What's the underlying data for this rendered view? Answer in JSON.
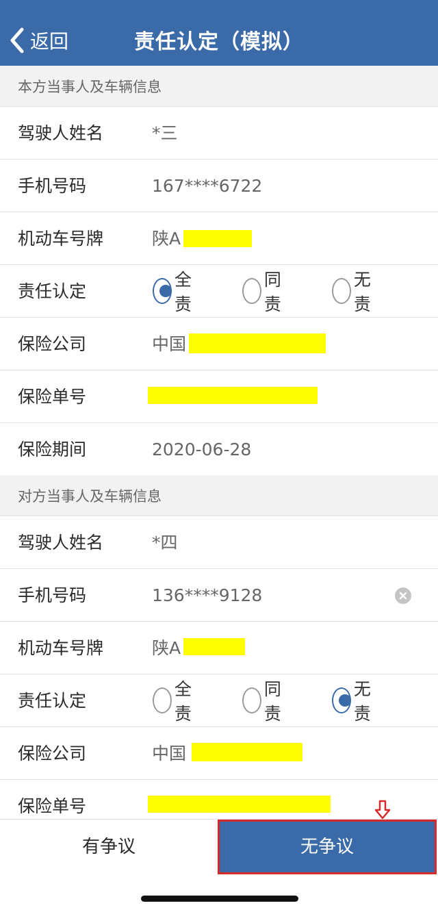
{
  "nav": {
    "back_label": "返回",
    "title": "责任认定（模拟）"
  },
  "own": {
    "header": "本方当事人及车辆信息",
    "driver_label": "驾驶人姓名",
    "driver_value": "*三",
    "phone_label": "手机号码",
    "phone_value": "167****6722",
    "plate_label": "机动车号牌",
    "plate_prefix": "陕A",
    "liability_label": "责任认定",
    "liability_options": [
      "全责",
      "同责",
      "无责"
    ],
    "liability_selected": "全责",
    "insurer_label": "保险公司",
    "insurer_prefix": "中国",
    "policy_label": "保险单号",
    "period_label": "保险期间",
    "period_value": "2020-06-28"
  },
  "other": {
    "header": "对方当事人及车辆信息",
    "driver_label": "驾驶人姓名",
    "driver_value": "*四",
    "phone_label": "手机号码",
    "phone_value": "136****9128",
    "plate_label": "机动车号牌",
    "plate_prefix": "陕A",
    "liability_label": "责任认定",
    "liability_options": [
      "全责",
      "同责",
      "无责"
    ],
    "liability_selected": "无责",
    "insurer_label": "保险公司",
    "insurer_prefix": "中国",
    "policy_label": "保险单号"
  },
  "footer": {
    "dispute_label": "有争议",
    "no_dispute_label": "无争议"
  },
  "colors": {
    "primary": "#3a6aa8",
    "highlight_border": "#d42a2a",
    "redaction": "#ffff00"
  },
  "icons": {
    "back": "chevron-left-icon",
    "clear": "clear-circle-icon",
    "indicator": "down-arrow-icon"
  }
}
